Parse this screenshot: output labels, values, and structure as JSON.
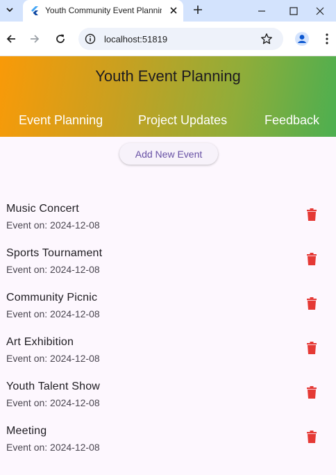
{
  "browser": {
    "tab_title": "Youth Community Event Planning",
    "url": "localhost:51819"
  },
  "app": {
    "title": "Youth Event Planning",
    "tabs": [
      "Event Planning",
      "Project Updates",
      "Feedback"
    ],
    "add_button_label": "Add New Event",
    "colors": {
      "gradient_start": "#f99a08",
      "gradient_end": "#4caf50",
      "delete_icon": "#e53935",
      "button_text": "#6750a4"
    }
  },
  "events": [
    {
      "name": "Music Concert",
      "date_label": "Event on: 2024-12-08"
    },
    {
      "name": "Sports Tournament",
      "date_label": "Event on: 2024-12-08"
    },
    {
      "name": "Community Picnic",
      "date_label": "Event on: 2024-12-08"
    },
    {
      "name": "Art Exhibition",
      "date_label": "Event on: 2024-12-08"
    },
    {
      "name": "Youth Talent Show",
      "date_label": "Event on: 2024-12-08"
    },
    {
      "name": "Meeting",
      "date_label": "Event on: 2024-12-08"
    }
  ]
}
